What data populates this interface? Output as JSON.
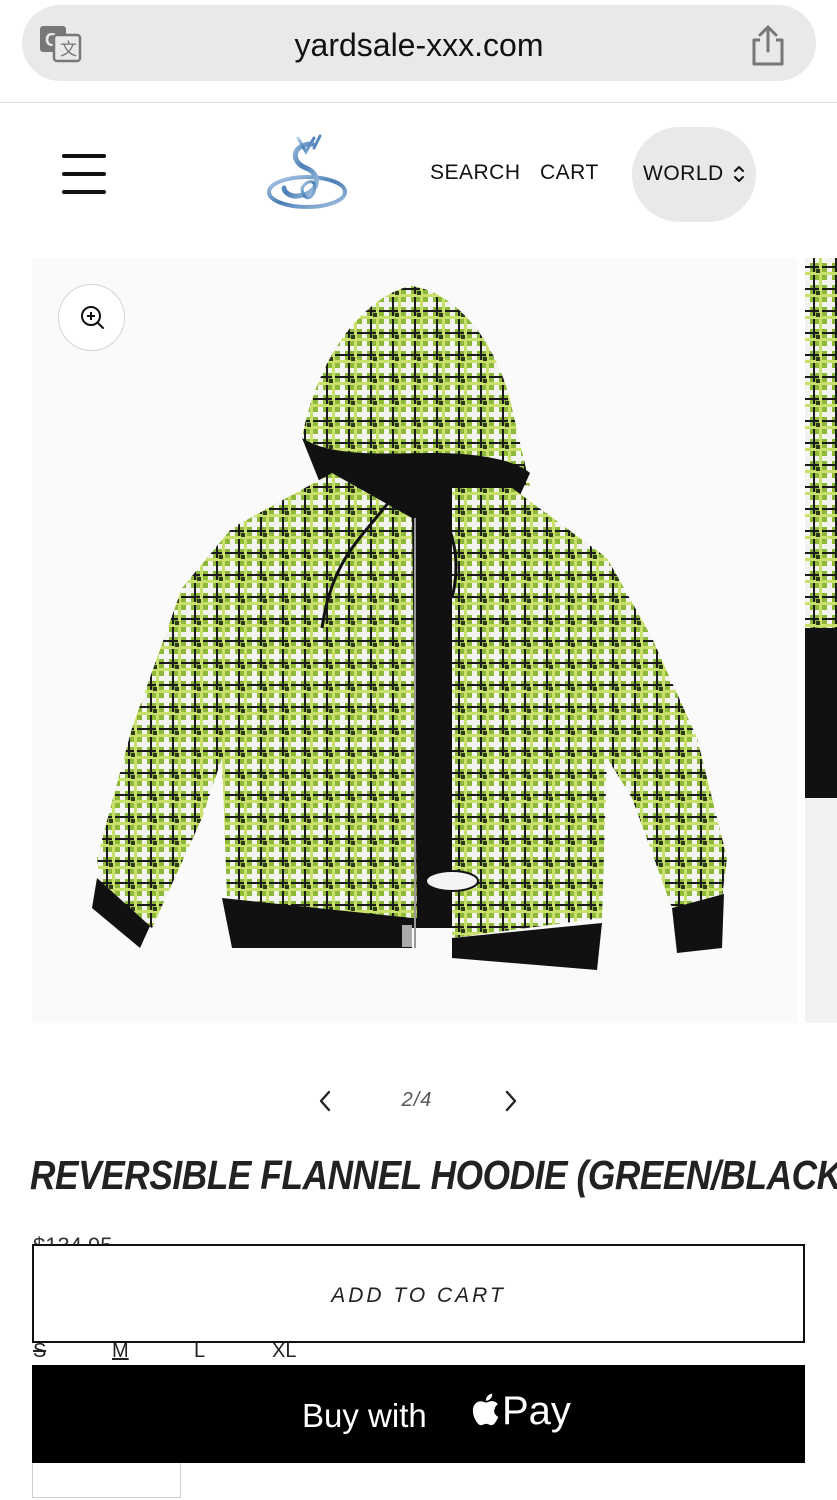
{
  "browser": {
    "url": "yardsale-xxx.com",
    "translate_icon": "translate-icon",
    "share_icon": "share-icon"
  },
  "header": {
    "menu_icon": "hamburger-menu-icon",
    "logo": "yardsale-logo",
    "nav": {
      "search": "SEARCH",
      "cart": "CART",
      "region": "WORLD"
    }
  },
  "gallery": {
    "zoom_icon": "zoom-in-icon",
    "image": "reversible-flannel-hoodie-photo",
    "pager": {
      "current": "2/4"
    },
    "colors": {
      "plaid_green": "#8db83a",
      "lining_black": "#111111"
    }
  },
  "product": {
    "title": "REVERSIBLE FLANNEL HOODIE (GREEN/BLACK)",
    "price": "$134.95",
    "sizes": [
      {
        "label": "S",
        "available": false
      },
      {
        "label": "M",
        "selected": true
      },
      {
        "label": "L"
      },
      {
        "label": "XL"
      }
    ],
    "add_to_cart_label": "ADD TO CART",
    "buy_with": "Buy with",
    "pay": "Pay"
  }
}
